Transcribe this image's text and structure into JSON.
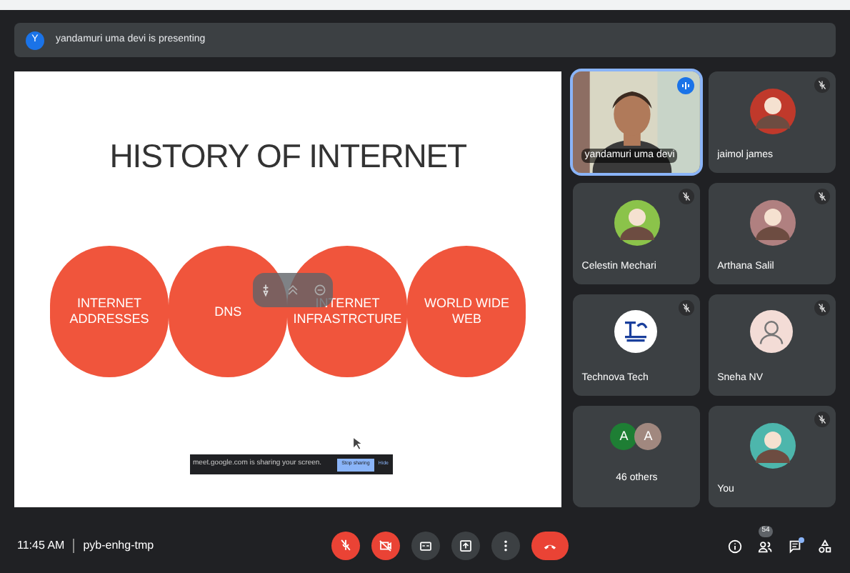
{
  "banner": {
    "initial": "Y",
    "text": "yandamuri uma devi is presenting"
  },
  "slide": {
    "title": "HISTORY OF INTERNET",
    "circles": [
      "INTERNET ADDRESSES",
      "DNS",
      "INTERNET INFRASTRCTURE",
      "WORLD WIDE WEB"
    ]
  },
  "share_bar": {
    "message": "meet.google.com is sharing your screen.",
    "stop": "Stop sharing",
    "hide": "Hide"
  },
  "participants": [
    {
      "kind": "video",
      "name": "yandamuri uma devi",
      "speaking": true,
      "muted": false
    },
    {
      "kind": "avatar",
      "name": "jaimol james",
      "speaking": false,
      "muted": true,
      "color": "#c0392b"
    },
    {
      "kind": "avatar",
      "name": "Celestin Mechari",
      "speaking": false,
      "muted": true,
      "color": "#8bc34a"
    },
    {
      "kind": "avatar",
      "name": "Arthana Salil",
      "speaking": false,
      "muted": true,
      "color": "#b08080"
    },
    {
      "kind": "logo",
      "name": "Technova Tech",
      "speaking": false,
      "muted": true
    },
    {
      "kind": "icon",
      "name": "Sneha NV",
      "speaking": false,
      "muted": true,
      "color": "#f3dcd6"
    },
    {
      "kind": "others",
      "name": "46 others",
      "speaking": false,
      "muted": false,
      "initials": [
        {
          "text": "A",
          "color": "#1e7e34"
        },
        {
          "text": "A",
          "color": "#a1887f"
        }
      ]
    },
    {
      "kind": "avatar",
      "name": "You",
      "speaking": false,
      "muted": true,
      "color": "#4db6ac"
    }
  ],
  "footer": {
    "time": "11:45 AM",
    "code": "pyb-enhg-tmp"
  },
  "controls": [
    {
      "kind": "mic",
      "off": true
    },
    {
      "kind": "camera",
      "off": true
    },
    {
      "kind": "captions",
      "off": false
    },
    {
      "kind": "present",
      "off": false
    },
    {
      "kind": "more",
      "off": false
    },
    {
      "kind": "leave",
      "off": true
    }
  ],
  "people_count": "54",
  "chat_unread": true
}
